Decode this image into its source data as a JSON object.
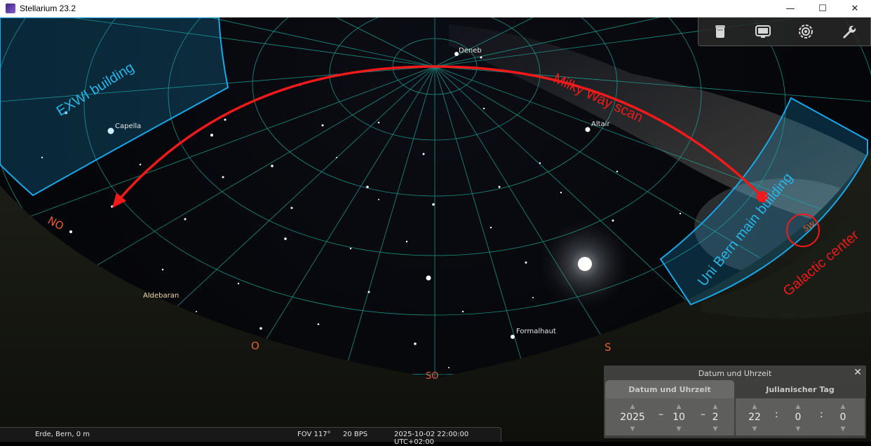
{
  "window": {
    "title": "Stellarium 23.2",
    "minimize": "—",
    "maximize": "☐",
    "close": "✕"
  },
  "stars": {
    "deneb": "Deneb",
    "capella": "Capella",
    "altair": "Altair",
    "aldebaran": "Aldebaran",
    "formalhaut": "Formalhaut"
  },
  "compass": {
    "no": "NO",
    "o": "O",
    "so": "SO",
    "s": "S",
    "sw": "SW"
  },
  "annotations": {
    "exwi": "EXWI building",
    "milky_way": "Milky Way scan",
    "uni_bern": "Uni Bern main building",
    "galactic_center": "Galactic center"
  },
  "toolbar": {
    "icons": [
      "trash-icon",
      "screen-icon",
      "target-icon",
      "wrench-icon"
    ]
  },
  "status": {
    "location": "Erde, Bern, 0 m",
    "fov": "FOV 117°",
    "fps": "20 BPS",
    "datetime": "2025-10-02 22:00:00 UTC+02:00"
  },
  "datetime_panel": {
    "title": "Datum und Uhrzeit",
    "close": "✕",
    "tab_date": "Datum und Uhrzeit",
    "tab_jd": "Julianischer Tag",
    "year": "2025",
    "month": "10",
    "day": "2",
    "hour": "22",
    "minute": "0",
    "second": "0",
    "date_sep": "–",
    "time_sep": ":"
  },
  "colors": {
    "grid": "#1fa898",
    "building_outline": "#1aa8ea",
    "scan_red": "#f01a1a",
    "compass": "#e5603a"
  }
}
